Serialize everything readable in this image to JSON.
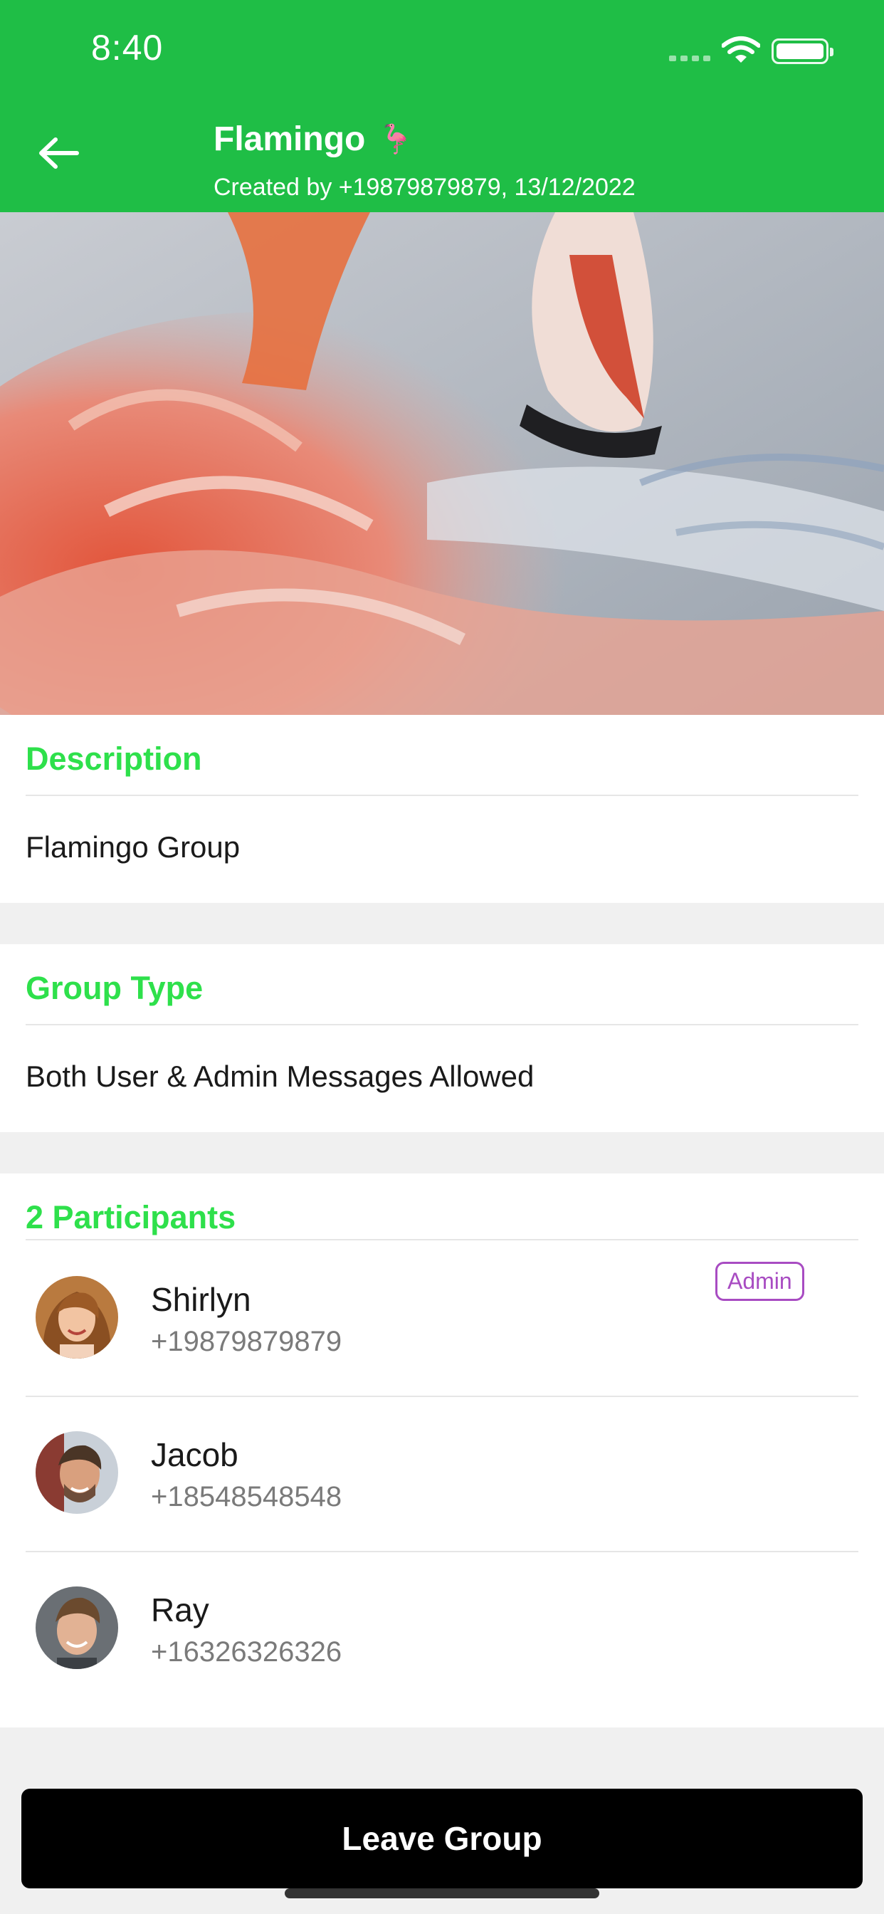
{
  "status_bar": {
    "time": "8:40"
  },
  "header": {
    "title": "Flamingo",
    "title_emoji": "🦩",
    "subtitle": "Created by +19879879879, 13/12/2022"
  },
  "description": {
    "heading": "Description",
    "text": "Flamingo Group"
  },
  "group_type": {
    "heading": "Group Type",
    "text": "Both User & Admin Messages Allowed"
  },
  "participants": {
    "heading": "2 Participants",
    "list": [
      {
        "name": "Shirlyn",
        "phone": "+19879879879",
        "badge": "Admin"
      },
      {
        "name": "Jacob",
        "phone": "+18548548548"
      },
      {
        "name": "Ray",
        "phone": "+16326326326"
      }
    ]
  },
  "actions": {
    "leave_label": "Leave Group"
  },
  "colors": {
    "header_green": "#1fbe46",
    "heading_green": "#2ee04b",
    "admin_purple": "#a84cc2"
  },
  "icons": [
    "back-arrow-icon",
    "wifi-icon",
    "battery-icon",
    "cellular-signal-icon"
  ]
}
